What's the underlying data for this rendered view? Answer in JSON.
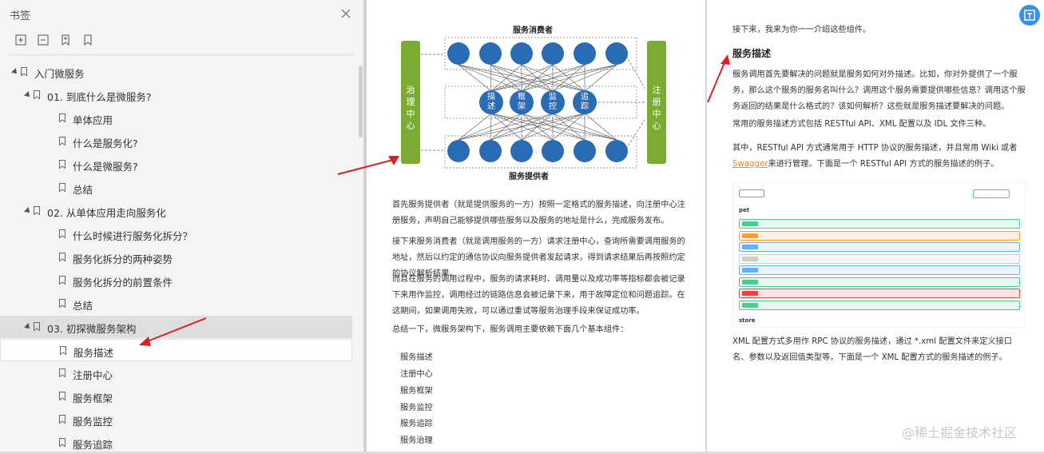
{
  "sidebar": {
    "title": "书签",
    "items": [
      {
        "label": "入门微服务"
      },
      {
        "label": "01. 到底什么是微服务?"
      },
      {
        "label": "单体应用"
      },
      {
        "label": "什么是服务化?"
      },
      {
        "label": "什么是微服务?"
      },
      {
        "label": "总结"
      },
      {
        "label": "02. 从单体应用走向服务化"
      },
      {
        "label": "什么时候进行服务化拆分？"
      },
      {
        "label": "服务化拆分的两种姿势"
      },
      {
        "label": "服务化拆分的前置条件"
      },
      {
        "label": "总结"
      },
      {
        "label": "03. 初探微服务架构"
      },
      {
        "label": "服务描述"
      },
      {
        "label": "注册中心"
      },
      {
        "label": "服务框架"
      },
      {
        "label": "服务监控"
      },
      {
        "label": "服务追踪"
      }
    ]
  },
  "diagram": {
    "top_label": "服务消费者",
    "bottom_label": "服务提供者",
    "left_bar": "治理中心",
    "right_bar": "注册中心",
    "middle": [
      "描述",
      "框架",
      "监控",
      "追踪"
    ]
  },
  "page1": {
    "p1": "首先服务提供者（就是提供服务的一方）按照一定格式的服务描述，向注册中心注册服务，声明自己能够提供哪些服务以及服务的地址是什么，完成服务发布。",
    "p2": "接下来服务消费者（就是调用服务的一方）请求注册中心，查询所需要调用服务的地址，然后以约定的通信协议向服务提供者发起请求，得到请求结果后再按照约定的协议解析结果。",
    "p3": "而且在服务的调用过程中，服务的请求耗时、调用量以及成功率等指标都会被记录下来用作监控，调用经过的链路信息会被记录下来，用于故障定位和问题追踪。在这期间，如果调用失败，可以通过重试等服务治理手段来保证成功率。",
    "p4": "总结一下，微服务架构下，服务调用主要依赖下面几个基本组件：",
    "components": [
      "服务描述",
      "注册中心",
      "服务框架",
      "服务监控",
      "服务追踪",
      "服务治理"
    ]
  },
  "page2": {
    "intro": "接下来，我来为你一一介绍这些组件。",
    "heading": "服务描述",
    "p1": "服务调用首先要解决的问题就是服务如何对外描述。比如，你对外提供了一个服务，那么这个服务的服务名叫什么？调用这个服务需要提供哪些信息？调用这个服务返回的结果是什么格式的？该如何解析？这些就是服务描述要解决的问题。",
    "p2": "常用的服务描述方式包括 RESTful API、XML 配置以及 IDL 文件三种。",
    "p3_pre": "其中，RESTful API 方式通常用于 HTTP 协议的服务描述，并且常用 Wiki 或者 ",
    "p3_link": "Swagger",
    "p3_post": "来进行管理。下面是一个 RESTful API 方式的服务描述的例子。",
    "p4": "XML 配置方式多用作 RPC 协议的服务描述，通过 *.xml 配置文件来定义接口名、参数以及返回值类型等。下面是一个 XML 配置方式的服务描述的例子。"
  },
  "swagger": {
    "section_pet": "pet",
    "section_store": "store",
    "rows": [
      {
        "method": "POST",
        "color": "#49cc90"
      },
      {
        "method": "PUT",
        "color": "#fca130"
      },
      {
        "method": "GET",
        "color": "#61affe"
      },
      {
        "method": "GET",
        "color": "#cccccc"
      },
      {
        "method": "GET",
        "color": "#61affe"
      },
      {
        "method": "POST",
        "color": "#49cc90"
      },
      {
        "method": "DELETE",
        "color": "#f93e3e"
      },
      {
        "method": "POST",
        "color": "#49cc90"
      }
    ]
  },
  "watermark": "@稀土掘金技术社区",
  "colors": {
    "node": "#2a6bb5",
    "bar": "#7cab34",
    "arrow": "#e02020"
  }
}
